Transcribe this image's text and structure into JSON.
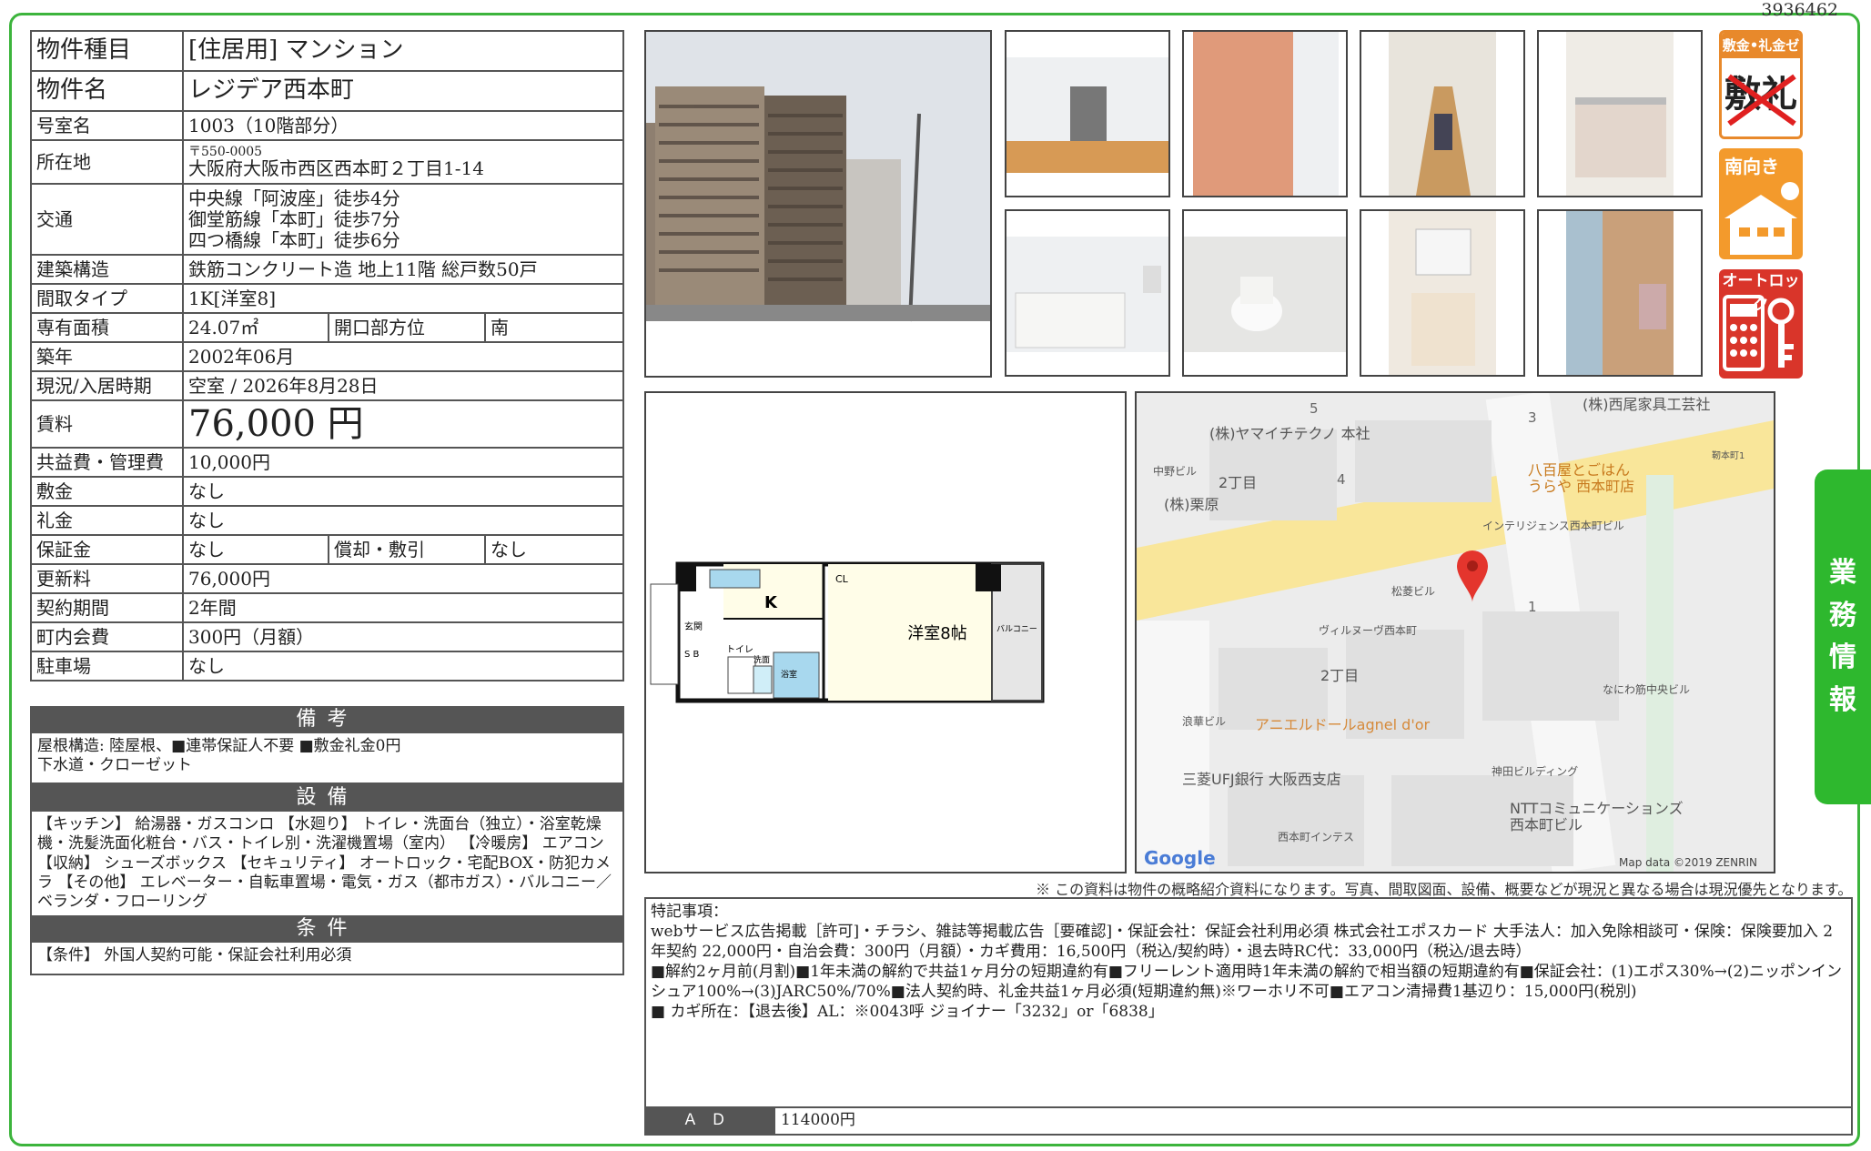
{
  "doc_id": "3936462",
  "spec": {
    "type_label": "物件種目",
    "type_value": "[住居用]  マンション",
    "name_label": "物件名",
    "name_value": "レジデア西本町",
    "room_label": "号室名",
    "room_value": "1003（10階部分）",
    "address_label": "所在地",
    "postal": "〒550-0005",
    "address_value": "大阪府大阪市西区西本町２丁目1-14",
    "access_label": "交通",
    "access": [
      "中央線「阿波座」徒歩4分",
      "御堂筋線「本町」徒歩7分",
      "四つ橋線「本町」徒歩6分"
    ],
    "structure_label": "建築構造",
    "structure_value": "鉄筋コンクリート造 地上11階 総戸数50戸",
    "layout_label": "間取タイプ",
    "layout_value": "1K[洋室8]",
    "area_label": "専有面積",
    "area_value": "24.07㎡",
    "facing_label": "開口部方位",
    "facing_value": "南",
    "built_label": "築年",
    "built_value": "2002年06月",
    "status_label": "現況/入居時期",
    "status_value": "空室 /  2026年8月28日",
    "rent_label": "賃料",
    "rent_value": "76,000 円",
    "fee_label": "共益費・管理費",
    "fee_value": "10,000円",
    "deposit_label": "敷金",
    "deposit_value": "なし",
    "keymoney_label": "礼金",
    "keymoney_value": "なし",
    "guarantee_label": "保証金",
    "guarantee_value": "なし",
    "amort_label": "償却・敷引",
    "amort_value": "なし",
    "renewal_label": "更新料",
    "renewal_value": "76,000円",
    "contract_label": "契約期間",
    "contract_value": "2年間",
    "townfee_label": "町内会費",
    "townfee_value": "300円（月額）",
    "parking_label": "駐車場",
    "parking_value": "なし"
  },
  "remarks_section": {
    "title": "備考",
    "lines": [
      "屋根構造: 陸屋根、■連帯保証人不要  ■敷金礼金0円",
      "下水道・クローゼット"
    ]
  },
  "facilities_section": {
    "title": "設備",
    "text": "【キッチン】 給湯器・ガスコンロ 【水廻り】 トイレ・洗面台（独立）・浴室乾燥機・洗髪洗面化粧台・バス・トイレ別・洗濯機置場（室内） 【冷暖房】 エアコン 【収納】 シューズボックス 【セキュリティ】 オートロック・宅配BOX・防犯カメラ 【その他】 エレベーター・自転車置場・電気・ガス（都市ガス）・バルコニー／ベランダ・フローリング"
  },
  "conditions_section": {
    "title": "条件",
    "text": "【条件】 外国人契約可能・保証会社利用必須"
  },
  "badges": {
    "zero": "敷金•礼金ゼロ",
    "zero_big": "敷礼",
    "south": "南向き",
    "autolock": "オートロック"
  },
  "side_tab": [
    "業",
    "務",
    "情",
    "報"
  ],
  "floorplan": {
    "k": "K",
    "cl": "CL",
    "room": "洋室8帖",
    "genkan": "玄関",
    "sb": "S B",
    "toilet": "トイレ",
    "wash": "洗面",
    "bath": "浴室",
    "balcony": "バルコニー"
  },
  "map": {
    "labels": [
      "(株)ヤマイチテクノ 本社",
      "(株)西尾家具工芸社",
      "八百屋とごはん",
      "うらや 西本町店",
      "(株)栗原",
      "インテリジェンス西本町ビル",
      "松菱ビル",
      "ヴィルヌーヴ西本町",
      "中野ビル",
      "2丁目",
      "2丁目",
      "なにわ筋中央ビル",
      "浪華ビル",
      "アニエルドールagnel d'or",
      "三菱UFJ銀行 大阪西支店",
      "神田ビルディング",
      "NTTコミュニケーションズ",
      "西本町ビル",
      "西本町インテス",
      "靭本町1"
    ],
    "numbers": [
      "5",
      "3",
      "4",
      "1"
    ],
    "google": "Google",
    "attribution": "Map data ©2019 ZENRIN"
  },
  "disclaimer": "※ この資料は物件の概略紹介資料になります。写真、間取図面、設備、概要などが現況と異なる場合は現況優先となります。",
  "special": {
    "title": "特記事項：",
    "lines": [
      "webサービス広告掲載［許可]・チラシ、雑誌等掲載広告［要確認]・保証会社：保証会社利用必須 株式会社エポスカード  大手法人：加入免除相談可・保険：保険要加入 2年契約 22,000円・自治会費：300円（月額）・カギ費用：16,500円（税込/契約時）・退去時RC代：33,000円（税込/退去時）",
      "■解約2ヶ月前(月割)■1年未満の解約で共益1ヶ月分の短期違約有■フリーレント適用時1年未満の解約で相当額の短期違約有■保証会社：(1)エポス30%→(2)ニッポンインシュア100%→(3)JARC50%/70%■法人契約時、礼金共益1ヶ月必須(短期違約無)※ワーホリ不可■エアコン清掃費1基辺り：15,000円(税別)",
      "■ カギ所在：【退去後】AL：※0043呼  ジョイナー「3232」or「6838」"
    ]
  },
  "ad": {
    "label": "ＡＤ",
    "value": "114000円"
  }
}
